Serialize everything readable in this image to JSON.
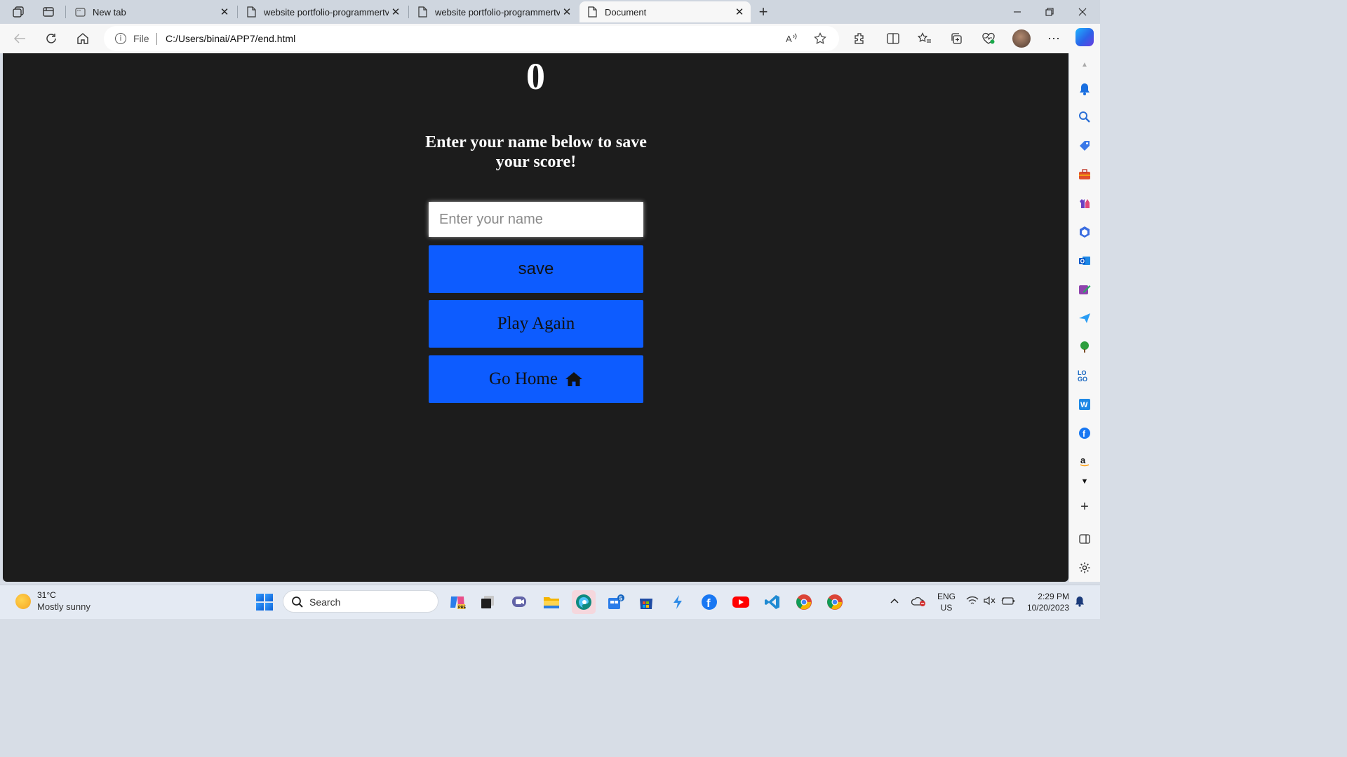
{
  "tabs": [
    {
      "title": "New tab"
    },
    {
      "title": "website portfolio-programmertv"
    },
    {
      "title": "website portfolio-programmertv"
    },
    {
      "title": "Document"
    }
  ],
  "address_bar": {
    "scheme": "File",
    "url": "C:/Users/binai/APP7/end.html"
  },
  "page": {
    "score": "0",
    "prompt": "Enter your name below to save your score!",
    "name_input": {
      "placeholder": "Enter your name",
      "value": ""
    },
    "save_label": "save",
    "play_again_label": "Play Again",
    "go_home_label": "Go Home"
  },
  "taskbar": {
    "weather_temp": "31°C",
    "weather_desc": "Mostly sunny",
    "search_label": "Search",
    "store_badge": "5",
    "lang_top": "ENG",
    "lang_bottom": "US",
    "time": "2:29 PM",
    "date": "10/20/2023"
  },
  "colors": {
    "page_bg": "#1c1c1c",
    "button_blue": "#0d5cff",
    "chrome_bg": "#f7f7f7"
  }
}
